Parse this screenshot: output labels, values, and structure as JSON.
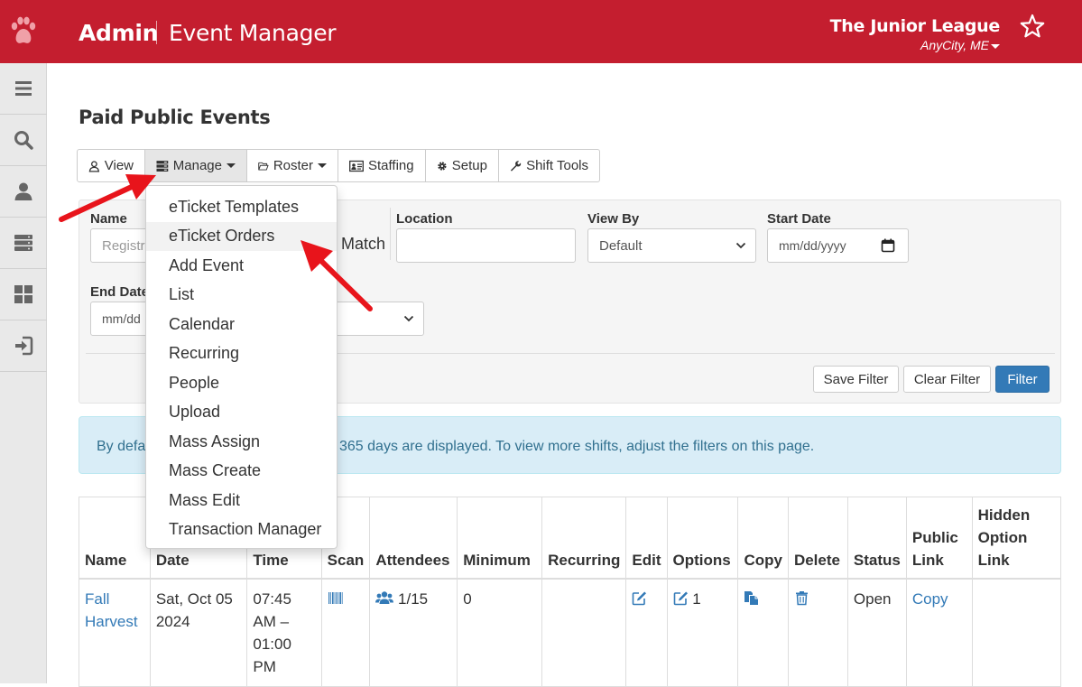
{
  "header": {
    "brand": "Admin",
    "app_title": "Event Manager",
    "org_name": "The Junior League",
    "org_location": "AnyCity, ME"
  },
  "sidebar": {
    "items": [
      {
        "icon": "menu-icon"
      },
      {
        "icon": "search-icon"
      },
      {
        "icon": "user-icon"
      },
      {
        "icon": "server-icon"
      },
      {
        "icon": "dashboard-icon"
      },
      {
        "icon": "sign-in-icon"
      }
    ]
  },
  "page": {
    "title": "Paid Public Events"
  },
  "toolbar": {
    "view": "View",
    "manage": "Manage",
    "roster": "Roster",
    "staffing": "Staffing",
    "setup": "Setup",
    "shift_tools": "Shift Tools"
  },
  "filters": {
    "name_label": "Name",
    "name_placeholder": "Registra",
    "match_text": "Match",
    "location_label": "Location",
    "location_value": "",
    "view_by_label": "View By",
    "view_by_value": "Default",
    "start_date_label": "Start Date",
    "start_date_value": "mm/dd/yyyy",
    "end_date_label": "End Date",
    "end_date_value": "mm/dd",
    "save_filter": "Save Filter",
    "clear_filter": "Clear Filter",
    "filter": "Filter"
  },
  "alert": {
    "text_start": "By defa",
    "text_end": "365 days are displayed. To view more shifts, adjust the filters on this page."
  },
  "manage_menu": {
    "items": [
      "eTicket Templates",
      "eTicket Orders",
      "Add Event",
      "List",
      "Calendar",
      "Recurring",
      "People",
      "Upload",
      "Mass Assign",
      "Mass Create",
      "Mass Edit",
      "Transaction Manager"
    ],
    "highlighted": "eTicket Orders"
  },
  "table": {
    "headers": [
      "Name",
      "Date",
      "Time",
      "Scan",
      "Attendees",
      "Minimum",
      "Recurring",
      "Edit",
      "Options",
      "Copy",
      "Delete",
      "Status",
      "Public Link",
      "Hidden Option Link"
    ],
    "rows": [
      {
        "name": "Fall Harvest",
        "date": "Sat, Oct 05 2024",
        "time": "07:45 AM – 01:00 PM",
        "attendees": "1/15",
        "minimum": "0",
        "recurring": "",
        "options": "1",
        "status": "Open",
        "public_link": "Copy",
        "hidden_link": ""
      }
    ]
  },
  "colors": {
    "header_bg": "#c41e2f",
    "link": "#337ab7",
    "primary_button": "#337ab7",
    "alert_bg": "#d9edf7",
    "annotation_arrow": "#e8141b"
  }
}
